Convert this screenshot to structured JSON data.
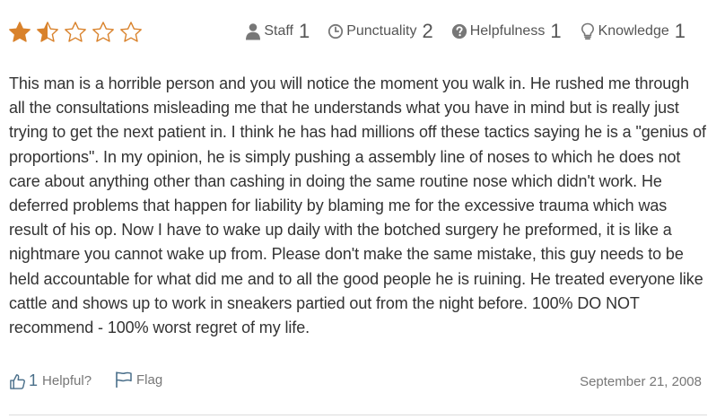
{
  "review": {
    "stars": {
      "rating": 1.5,
      "max": 5,
      "color": "#d9822b"
    },
    "ratings": [
      {
        "label": "Staff",
        "value": "1",
        "icon": "person-icon"
      },
      {
        "label": "Punctuality",
        "value": "2",
        "icon": "clock-icon"
      },
      {
        "label": "Helpfulness",
        "value": "1",
        "icon": "question-circle-icon"
      },
      {
        "label": "Knowledge",
        "value": "1",
        "icon": "lightbulb-icon"
      }
    ],
    "text": "This man is a horrible person and you will notice the moment you walk in. He rushed me through all the consultations misleading me that he understands what you have in mind but is really just trying to get the next patient in. I think he has had millions off these tactics saying he is a \"genius of proportions\". In my opinion, he is simply pushing a assembly line of noses to which he does not care about anything other than cashing in doing the same routine nose which didn't work. He deferred problems that happen for liability by blaming me for the excessive trauma which was result of his op. Now I have to wake up daily with the botched surgery he preformed, it is like a nightmare you cannot wake up from. Please don't make the same mistake, this guy needs to be held accountable for what did me and to all the good people he is ruining. He treated everyone like cattle and shows up to work in sneakers partied out from the night before. 100% DO NOT recommend - 100% worst regret of my life.",
    "footer": {
      "helpful_count": "1",
      "helpful_label": "Helpful?",
      "flag_label": "Flag",
      "date": "September 21, 2008"
    },
    "colors": {
      "icon_gray": "#777777",
      "link_blue": "#4a6f8a"
    }
  }
}
